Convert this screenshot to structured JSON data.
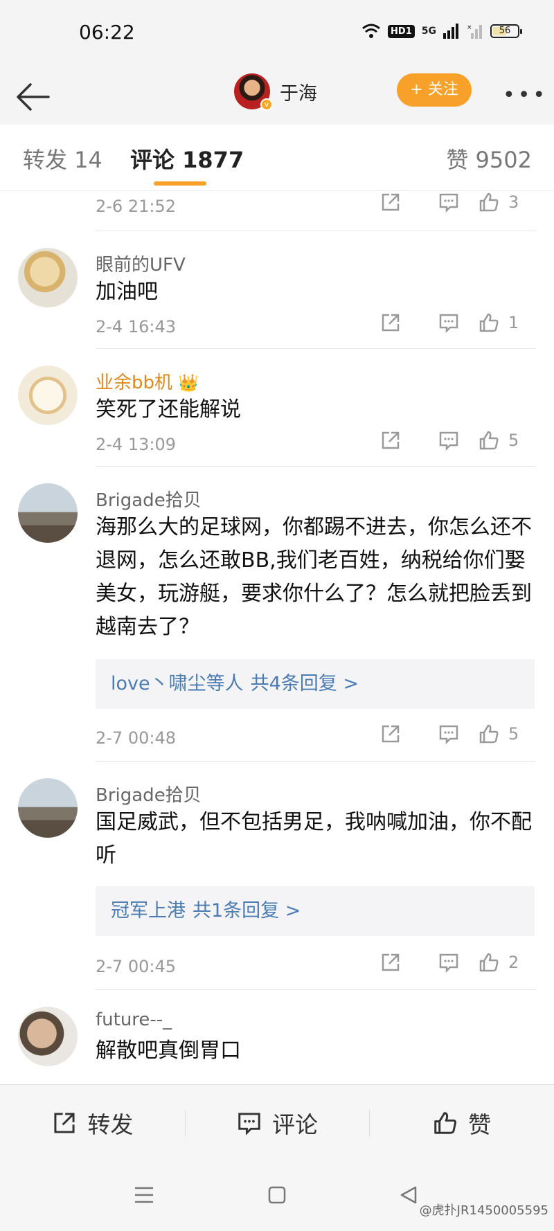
{
  "status_bar": {
    "time": "06:22",
    "hd_label": "HD1",
    "network_label": "5G",
    "battery": "56",
    "battery_level_percent": 56
  },
  "header": {
    "title": "于海",
    "follow_label": "+ 关注"
  },
  "tabs": {
    "forward": "转发 14",
    "comments": "评论 1877",
    "likes": "赞 9502"
  },
  "comments": [
    {
      "author": "",
      "text": "",
      "time": "2-6 21:52",
      "likes": "3"
    },
    {
      "author": "眼前的UFV",
      "text": "加油吧",
      "time": "2-4 16:43",
      "likes": "1"
    },
    {
      "author": "业余bb机",
      "text": "笑死了还能解说",
      "time": "2-4 13:09",
      "likes": "5"
    },
    {
      "author": "Brigade拾贝",
      "text": "海那么大的足球网，你都踢不进去，你怎么还不退网，怎么还敢BB,我们老百姓，纳税给你们娶美女，玩游艇，要求你什么了？怎么就把脸丢到越南去了？",
      "reply_names": "love丶啸尘等人",
      "reply_count": "共4条回复 >",
      "time": "2-7 00:48",
      "likes": "5"
    },
    {
      "author": "Brigade拾贝",
      "text": "国足威武，但不包括男足，我呐喊加油，你不配听",
      "reply_names": "冠军上港",
      "reply_count": "共1条回复 >",
      "time": "2-7 00:45",
      "likes": "2"
    },
    {
      "author": "future--_",
      "text": "解散吧真倒胃口",
      "time": "",
      "likes": ""
    }
  ],
  "bottom_bar": {
    "forward": "转发",
    "comment": "评论",
    "like": "赞"
  },
  "watermark": "@虎扑JR1450005595",
  "colors": {
    "accent": "#f7a12b",
    "link": "#4a7bb2",
    "vip_name": "#e08a1e"
  }
}
